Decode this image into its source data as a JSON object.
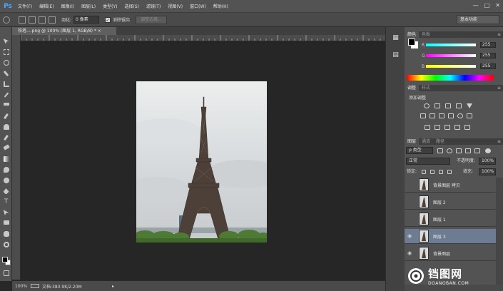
{
  "app": {
    "logo": "Ps"
  },
  "menu": [
    "文件(F)",
    "编辑(E)",
    "图像(I)",
    "图层(L)",
    "类型(Y)",
    "选择(S)",
    "滤镜(T)",
    "视图(V)",
    "窗口(W)",
    "帮助(H)"
  ],
  "window_controls": {
    "minimize": "—",
    "maximize": "□",
    "close": "✕"
  },
  "options_bar": {
    "feather_label": "羽化:",
    "feather_value": "0 像素",
    "antialias_check": "✓",
    "antialias_label": "消除锯齿",
    "refine_edge": "调整边缘...",
    "workspace": "基本功能"
  },
  "document": {
    "tab_title": "铁塔....png @ 100% (图层 1, RGB/8) *  ×"
  },
  "status": {
    "zoom": "100%",
    "doc_info": "文档:383.9K/2.20M",
    "arrow": "▸"
  },
  "panels": {
    "color": {
      "tabs": [
        "颜色",
        "色板"
      ],
      "menu": "≡",
      "channels": [
        {
          "letter": "R",
          "value": "255"
        },
        {
          "letter": "G",
          "value": "255"
        },
        {
          "letter": "B",
          "value": "255"
        }
      ]
    },
    "adjustments": {
      "tabs": [
        "调整",
        "样式"
      ],
      "title": "添加调整"
    },
    "layers": {
      "tabs": [
        "图层",
        "通道",
        "路径"
      ],
      "filter": "ρ 类型",
      "blend_mode": "正常",
      "opacity_label": "不透明度:",
      "opacity_value": "100%",
      "lock_label": "锁定:",
      "fill_label": "填充:",
      "fill_value": "100%",
      "items": [
        {
          "name": "背景图层 拷贝",
          "visible": false,
          "selected": false
        },
        {
          "name": "图层 2",
          "visible": false,
          "selected": false
        },
        {
          "name": "图层 1",
          "visible": false,
          "selected": false
        },
        {
          "name": "图层 3",
          "visible": true,
          "selected": true
        },
        {
          "name": "背景图层",
          "visible": true,
          "selected": false
        }
      ]
    }
  },
  "watermark": {
    "text": "铛图网",
    "sub": "DOANOBAN.COM"
  },
  "colors": {
    "selected_layer": "#6e7c93",
    "accent_blue": "#4aa8ff"
  }
}
